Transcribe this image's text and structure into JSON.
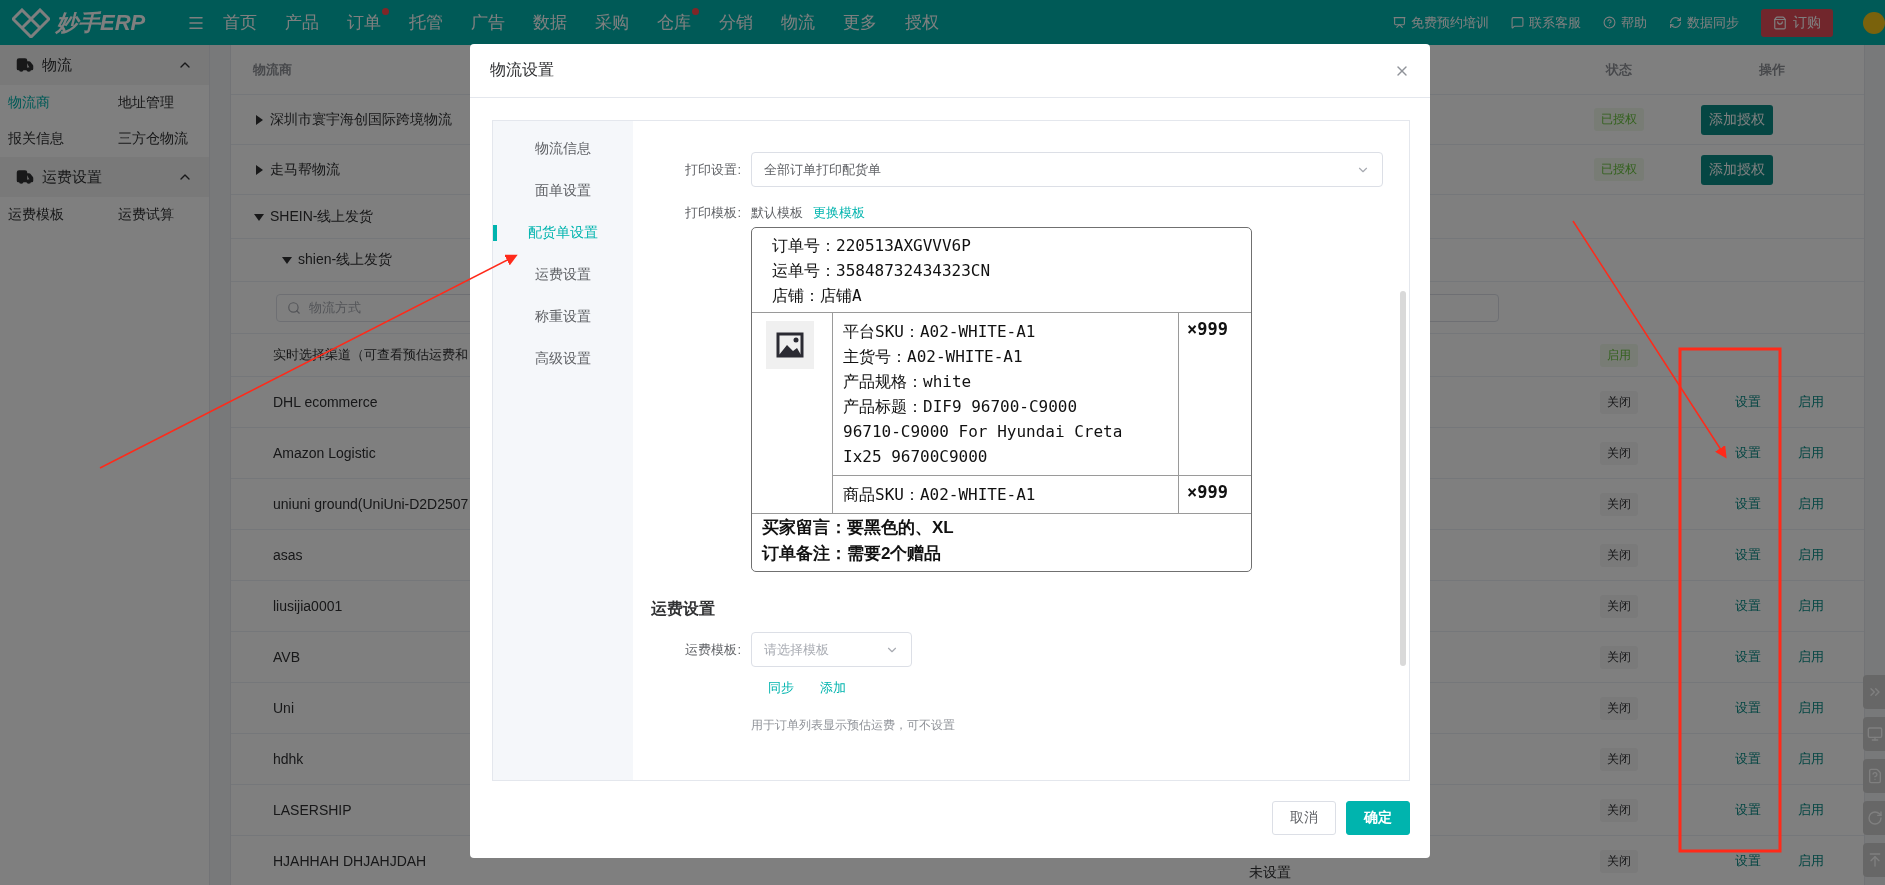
{
  "header": {
    "logo": "妙手ERP",
    "nav": [
      {
        "label": "首页",
        "dot": false
      },
      {
        "label": "产品",
        "dot": false
      },
      {
        "label": "订单",
        "dot": true
      },
      {
        "label": "托管",
        "dot": false
      },
      {
        "label": "广告",
        "dot": false
      },
      {
        "label": "数据",
        "dot": false
      },
      {
        "label": "采购",
        "dot": false
      },
      {
        "label": "仓库",
        "dot": true
      },
      {
        "label": "分销",
        "dot": false
      },
      {
        "label": "物流",
        "dot": false
      },
      {
        "label": "更多",
        "dot": false
      },
      {
        "label": "授权",
        "dot": false
      }
    ],
    "links": [
      {
        "kind": "training",
        "label": "免费预约培训"
      },
      {
        "kind": "service",
        "label": "联系客服"
      },
      {
        "kind": "help",
        "label": "帮助"
      },
      {
        "kind": "sync",
        "label": "数据同步"
      }
    ],
    "order_button": "订购"
  },
  "sidebar": {
    "groups": [
      {
        "title": "物流",
        "expanded": true,
        "items": [
          {
            "label": "物流商",
            "selected": true
          },
          {
            "label": "地址管理",
            "selected": false
          },
          {
            "label": "报关信息",
            "selected": false
          },
          {
            "label": "三方仓物流",
            "selected": false
          }
        ]
      },
      {
        "title": "运费设置",
        "expanded": true,
        "items": [
          {
            "label": "运费模板",
            "selected": false
          },
          {
            "label": "运费试算",
            "selected": false
          }
        ]
      }
    ]
  },
  "table": {
    "columns": {
      "name": "物流商",
      "status": "状态",
      "actions": "操作"
    },
    "rows": [
      {
        "kind": "carrier",
        "name": "深圳市寰宇海创国际跨境物流",
        "expanded": false,
        "status": {
          "label": "已授权",
          "kind": "success"
        },
        "button": "添加授权"
      },
      {
        "kind": "carrier",
        "name": "走马帮物流",
        "expanded": false,
        "status": {
          "label": "已授权",
          "kind": "success"
        },
        "button": "添加授权"
      },
      {
        "kind": "carrier",
        "name": "SHEIN-线上发货",
        "expanded": true
      },
      {
        "kind": "subgroup",
        "name": "shien-线上发货",
        "expanded": true
      },
      {
        "kind": "search",
        "placeholder": "物流方式"
      },
      {
        "kind": "channel",
        "name": "实时选择渠道（可查看预估运费和",
        "status": {
          "label": "启用",
          "kind": "success"
        }
      },
      {
        "kind": "channel",
        "name": "DHL ecommerce",
        "status": {
          "label": "关闭",
          "kind": "neutral"
        },
        "actions": [
          "设置",
          "启用"
        ]
      },
      {
        "kind": "channel",
        "name": "Amazon Logistic",
        "status": {
          "label": "关闭",
          "kind": "neutral"
        },
        "actions": [
          "设置",
          "启用"
        ]
      },
      {
        "kind": "channel",
        "name": "uniuni ground(UniUni-D2D2507",
        "status": {
          "label": "关闭",
          "kind": "neutral"
        },
        "actions": [
          "设置",
          "启用"
        ]
      },
      {
        "kind": "channel",
        "name": "asas",
        "status": {
          "label": "关闭",
          "kind": "neutral"
        },
        "actions": [
          "设置",
          "启用"
        ]
      },
      {
        "kind": "channel",
        "name": "liusijia0001",
        "status": {
          "label": "关闭",
          "kind": "neutral"
        },
        "actions": [
          "设置",
          "启用"
        ]
      },
      {
        "kind": "channel",
        "name": "AVB",
        "status": {
          "label": "关闭",
          "kind": "neutral"
        },
        "actions": [
          "设置",
          "启用"
        ]
      },
      {
        "kind": "channel",
        "name": "Uni",
        "status": {
          "label": "关闭",
          "kind": "neutral"
        },
        "actions": [
          "设置",
          "启用"
        ]
      },
      {
        "kind": "channel",
        "name": "hdhk",
        "status": {
          "label": "关闭",
          "kind": "neutral"
        },
        "actions": [
          "设置",
          "启用"
        ]
      },
      {
        "kind": "channel",
        "name": "LASERSHIP",
        "status": {
          "label": "关闭",
          "kind": "neutral"
        },
        "actions": [
          "设置",
          "启用"
        ]
      },
      {
        "kind": "channel",
        "name": "HJAHHAH DHJAHJDAH",
        "column_2": "未设置",
        "status": {
          "label": "关闭",
          "kind": "neutral"
        },
        "actions": [
          "设置",
          "启用"
        ]
      }
    ]
  },
  "modal": {
    "title": "物流设置",
    "nav": [
      {
        "label": "物流信息",
        "selected": false
      },
      {
        "label": "面单设置",
        "selected": false
      },
      {
        "label": "配货单设置",
        "selected": true
      },
      {
        "label": "运费设置",
        "selected": false
      },
      {
        "label": "称重设置",
        "selected": false
      },
      {
        "label": "高级设置",
        "selected": false
      }
    ],
    "print": {
      "setting_label": "打印设置:",
      "setting_value": "全部订单打印配货单",
      "template_label": "打印模板:",
      "template_name": "默认模板",
      "template_link": "更换模板"
    },
    "slip": {
      "header_lines": [
        "订单号：220513AXGVVV6P",
        "运单号：35848732434323CN",
        "店铺：店铺A"
      ],
      "item_lines": [
        "平台SKU：A02-WHITE-A1",
        "主货号：A02-WHITE-A1",
        "产品规格：white",
        "产品标题：DIF9 96700-C9000",
        "96710-C9000 For Hyundai Creta",
        "Ix25 96700C9000"
      ],
      "quantity": "×999",
      "sku_line": "商品SKU：A02-WHITE-A1",
      "sku_quantity": "×999",
      "note_lines": [
        "买家留言：要黑色的、XL",
        "订单备注：需要2个赠品"
      ]
    },
    "freight": {
      "heading": "运费设置",
      "template_label": "运费模板:",
      "placeholder": "请选择模板",
      "links": [
        "同步",
        "添加"
      ],
      "hint": "用于订单列表显示预估运费，可不设置"
    },
    "buttons": [
      {
        "label": "取消",
        "primary": false
      },
      {
        "label": "确定",
        "primary": true
      }
    ]
  }
}
